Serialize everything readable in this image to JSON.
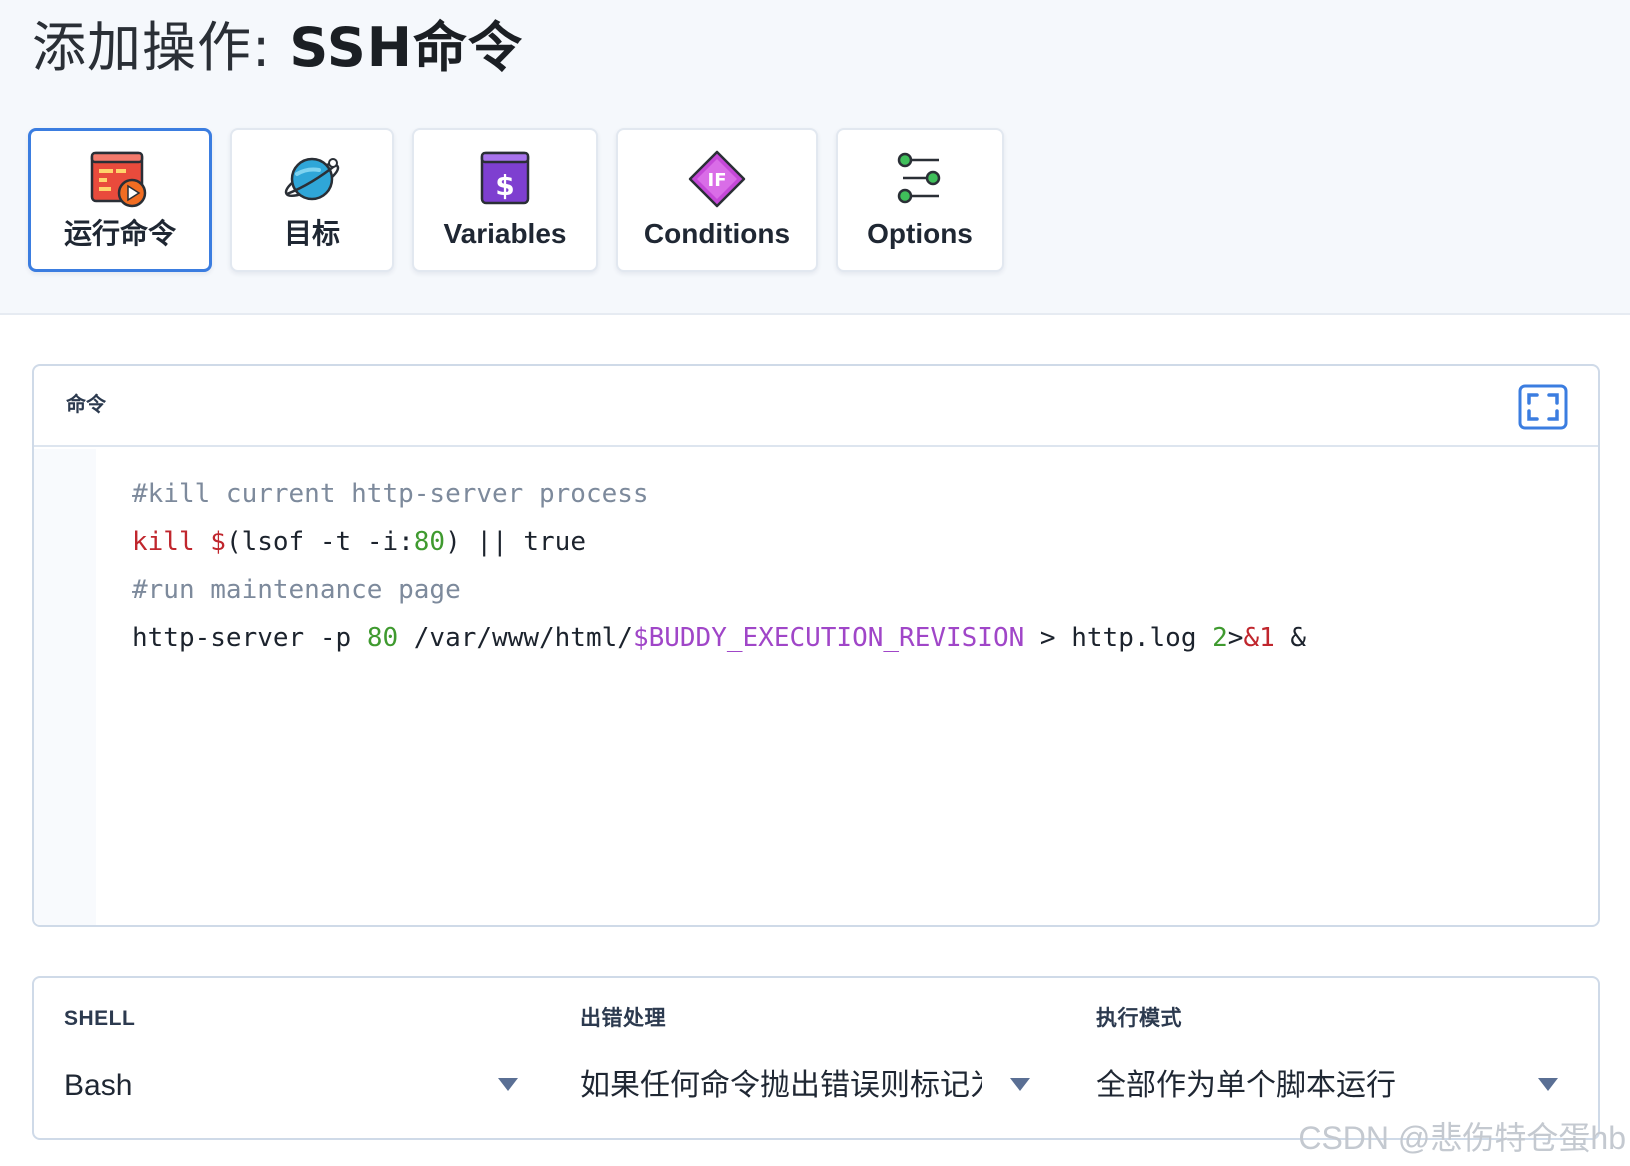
{
  "page": {
    "title_prefix": "添加操作: ",
    "title_action": "SSH命令"
  },
  "tabs": [
    {
      "label": "运行命令",
      "icon": "run-command-icon",
      "active": true
    },
    {
      "label": "目标",
      "icon": "planet-target-icon",
      "active": false
    },
    {
      "label": "Variables",
      "icon": "dollar-variable-icon",
      "active": false
    },
    {
      "label": "Conditions",
      "icon": "if-diamond-icon",
      "active": false
    },
    {
      "label": "Options",
      "icon": "sliders-options-icon",
      "active": false
    }
  ],
  "command_panel": {
    "label": "命令",
    "expand_icon": "fullscreen-expand-icon",
    "lines": [
      {
        "segments": [
          {
            "t": "#kill current http-server process",
            "c": "comment"
          }
        ]
      },
      {
        "segments": [
          {
            "t": "kill",
            "c": "kw"
          },
          {
            "t": " ",
            "c": "plain"
          },
          {
            "t": "$",
            "c": "kw"
          },
          {
            "t": "(lsof -t -i:",
            "c": "plain"
          },
          {
            "t": "80",
            "c": "num"
          },
          {
            "t": ") || true",
            "c": "plain"
          }
        ]
      },
      {
        "segments": [
          {
            "t": "#run maintenance page",
            "c": "comment"
          }
        ]
      },
      {
        "segments": [
          {
            "t": "http-server -p ",
            "c": "plain"
          },
          {
            "t": "80",
            "c": "num"
          },
          {
            "t": " /var/www/html/",
            "c": "plain"
          },
          {
            "t": "$BUDDY_EXECUTION_REVISION",
            "c": "var"
          },
          {
            "t": " > http.log ",
            "c": "plain"
          },
          {
            "t": "2",
            "c": "num"
          },
          {
            "t": ">",
            "c": "plain"
          },
          {
            "t": "&1",
            "c": "kw"
          },
          {
            "t": " &",
            "c": "plain"
          }
        ]
      }
    ]
  },
  "settings": {
    "shell": {
      "label": "SHELL",
      "value": "Bash"
    },
    "error_handling": {
      "label": "出错处理",
      "value": "如果任何命令抛出错误则标记为失败"
    },
    "exec_mode": {
      "label": "执行模式",
      "value": "全部作为单个脚本运行"
    }
  },
  "colors": {
    "accent": "#3b7de0",
    "comment": "#7d8a9c",
    "keyword": "#c0262d",
    "number": "#3f9a2f",
    "variable": "#a046c8"
  },
  "watermark": "CSDN @悲伤特仓蛋hb"
}
